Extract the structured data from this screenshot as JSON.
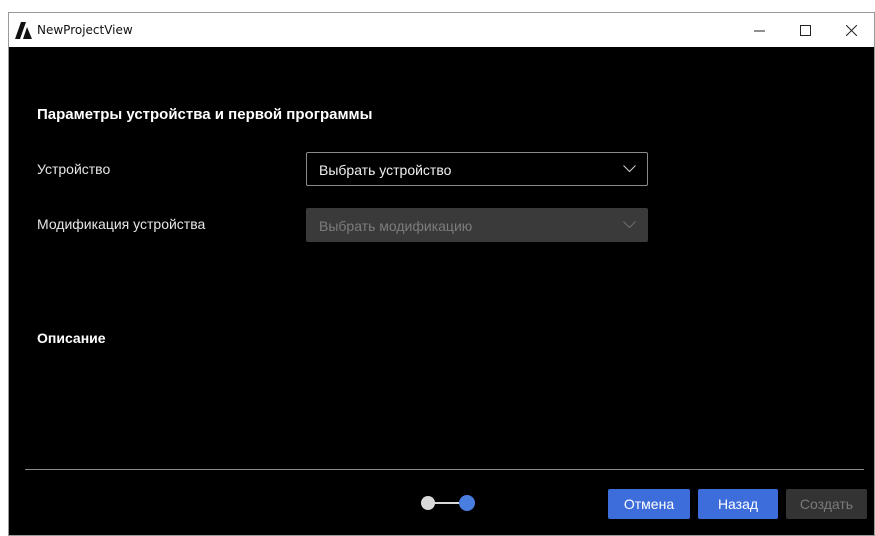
{
  "window": {
    "title": "NewProjectView",
    "controls": {
      "minimize": "minimize-icon",
      "maximize": "maximize-icon",
      "close": "close-icon"
    }
  },
  "form": {
    "section_title": "Параметры устройства и первой программы",
    "device": {
      "label": "Устройство",
      "value": "Выбрать устройство"
    },
    "modification": {
      "label": "Модификация устройства",
      "value": "Выбрать модификацию",
      "disabled": true
    },
    "description_title": "Описание"
  },
  "stepper": {
    "current_step": 2,
    "total_steps": 2
  },
  "footer": {
    "cancel_label": "Отмена",
    "back_label": "Назад",
    "create_label": "Создать",
    "create_disabled": true
  },
  "colors": {
    "accent": "#3c6ddb",
    "background": "#000000",
    "disabled_bg": "#333333"
  }
}
